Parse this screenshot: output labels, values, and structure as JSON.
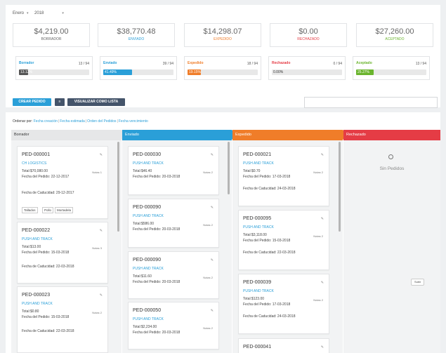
{
  "filters": {
    "period": "Enero",
    "year": "2018"
  },
  "stats": [
    {
      "amount": "$4,219.00",
      "label": "BORRADOR",
      "color": "#666666"
    },
    {
      "amount": "$38,770.48",
      "label": "ENVIADO",
      "color": "#2a9fd8"
    },
    {
      "amount": "$14,298.07",
      "label": "EXPEDIDO",
      "color": "#f07d29"
    },
    {
      "amount": "$0.00",
      "label": "RECHAZADO",
      "color": "#e53c45"
    },
    {
      "amount": "$27,260.00",
      "label": "ACEPTADO",
      "color": "#6ab42d"
    }
  ],
  "progress": [
    {
      "label": "Borrador",
      "count": "13 / 94",
      "pct_label": "13.12%",
      "pct": 13.12,
      "color": "#555555",
      "label_color": "#2a9fd8"
    },
    {
      "label": "Enviado",
      "count": "39 / 94",
      "pct_label": "41.49%",
      "pct": 41.49,
      "color": "#2a9fd8",
      "label_color": "#2a9fd8"
    },
    {
      "label": "Expedido",
      "count": "18 / 94",
      "pct_label": "19.15%",
      "pct": 19.15,
      "color": "#f07d29",
      "label_color": "#f07d29"
    },
    {
      "label": "Rechazado",
      "count": "0 / 94",
      "pct_label": "0.00%",
      "pct": 0,
      "color": "#e53c45",
      "label_color": "#e53c45"
    },
    {
      "label": "Aceptado",
      "count": "13 / 94",
      "pct_label": "25.27%",
      "pct": 25.27,
      "color": "#6ab42d",
      "label_color": "#6ab42d"
    }
  ],
  "toolbar": {
    "create_label": "CREAR PEDIDO",
    "toggle_label": "≡",
    "list_label": "VISUALIZAR COMO LISTA",
    "search_placeholder": ""
  },
  "sort": {
    "prefix": "Ordenar por:",
    "options": [
      "Fecha creación",
      "Fecha estimada",
      "Orden del Pedidos",
      "Fecha vencimiento"
    ]
  },
  "columns": [
    {
      "title": "Borrador",
      "color": "#e6e7e8",
      "text_color": "#333333",
      "cards": [
        {
          "id": "PED-000001",
          "client": "CH LOGISTICS",
          "total": "Total:$70,080.00",
          "pedido": "Fecha del Pedido: 22-12-2017",
          "cad": "Fecha de Caducidad: 29-12-2017",
          "notes": "Notas 1",
          "tags": [
            "Tallados",
            "Pollo",
            "Mortadela"
          ]
        },
        {
          "id": "PED-000022",
          "client": "PUSH AND TRACK",
          "total": "Total:$13.00",
          "pedido": "Fecha del Pedido: 15-03-2018",
          "cad": "Fecha de Caducidad: 22-03-2018",
          "notes": "Notas 3"
        },
        {
          "id": "PED-000023",
          "client": "PUSH AND TRACK",
          "total": "Total:$0.80",
          "pedido": "Fecha del Pedido: 15-03-2018",
          "cad": "Fecha de Caducidad: 22-03-2018",
          "notes": "Notas 2"
        }
      ]
    },
    {
      "title": "Enviado",
      "color": "#2a9fd8",
      "text_color": "#ffffff",
      "cards": [
        {
          "id": "PED-000030",
          "client": "PUSH AND TRACK",
          "total": "Total:$46.40",
          "pedido": "Fecha del Pedido: 20-03-2018",
          "notes": "Notas 2"
        },
        {
          "id": "PED-000090",
          "client": "PUSH AND TRACK",
          "total": "Total:$586.00",
          "pedido": "Fecha del Pedido: 20-03-2018",
          "notes": "Notas 2"
        },
        {
          "id": "PED-000090",
          "client": "PUSH AND TRACK",
          "total": "Total:$11.60",
          "pedido": "Fecha del Pedido: 20-03-2018",
          "notes": "Notas 2"
        },
        {
          "id": "PED-000050",
          "client": "PUSH AND TRACK",
          "total": "Total:$2,234.00",
          "pedido": "Fecha del Pedido: 20-03-2018",
          "notes": "Notas 2"
        }
      ]
    },
    {
      "title": "Expedido",
      "color": "#f07d29",
      "text_color": "#ffffff",
      "cards": [
        {
          "id": "PED-000021",
          "client": "PUSH AND TRACK",
          "total": "Total:$0.70",
          "pedido": "Fecha del Pedido: 17-03-2018",
          "cad": "Fecha de Caducidad: 24-03-2018",
          "notes": "Notas 2"
        },
        {
          "id": "PED-000095",
          "client": "PUSH AND TRACK",
          "total": "Total:$3,118.00",
          "pedido": "Fecha del Pedido: 15-03-2018",
          "cad": "Fecha de Caducidad: 22-03-2018",
          "notes": "Notas 2"
        },
        {
          "id": "PED-000039",
          "client": "PUSH AND TRACK",
          "total": "Total:$123.00",
          "pedido": "Fecha del Pedido: 17-03-2018",
          "cad": "Fecha de Caducidad: 24-03-2018",
          "notes": "Notas 2"
        },
        {
          "id": "PED-000041",
          "client": "",
          "total": "",
          "pedido": "",
          "notes": ""
        }
      ]
    },
    {
      "title": "Rechazado",
      "color": "#e53c45",
      "text_color": "#ffffff",
      "empty_text": "Sin Pedidos",
      "cards": []
    }
  ],
  "tooltip": "Subir"
}
